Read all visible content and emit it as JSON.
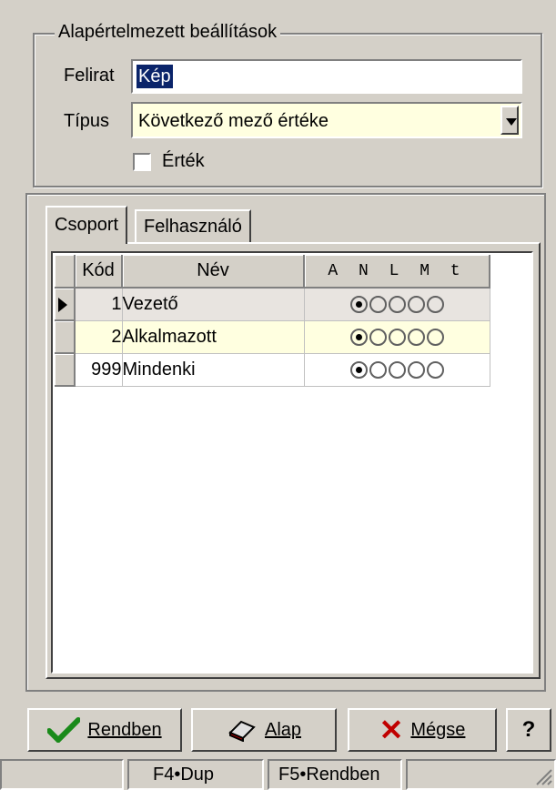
{
  "groupbox": {
    "title": "Alapértelmezett beállítások"
  },
  "felirat": {
    "label": "Felirat",
    "value": "Kép"
  },
  "tipus": {
    "label": "Típus",
    "value": "Következő  mező értéke"
  },
  "ertek": {
    "label": "Érték",
    "checked": false
  },
  "tabs": [
    {
      "label": "Csoport",
      "active": true
    },
    {
      "label": "Felhasználó",
      "active": false
    }
  ],
  "grid": {
    "columns": [
      "Kód",
      "Név",
      "A N L M t"
    ],
    "rows": [
      {
        "kod": "1",
        "nev": "Vezető",
        "selected_option": 1
      },
      {
        "kod": "2",
        "nev": "Alkalmazott",
        "selected_option": 1
      },
      {
        "kod": "999",
        "nev": "Mindenki",
        "selected_option": 1
      }
    ]
  },
  "buttons": {
    "ok": "Rendben",
    "alap": "Alap",
    "cancel": "Mégse",
    "help": "?"
  },
  "status": [
    "",
    "F4•Dup",
    "F5•Rendben",
    ""
  ],
  "colors": {
    "face": "#d4d0c8",
    "highlight_row": "#ffffe0",
    "selection": "#0a246a"
  }
}
